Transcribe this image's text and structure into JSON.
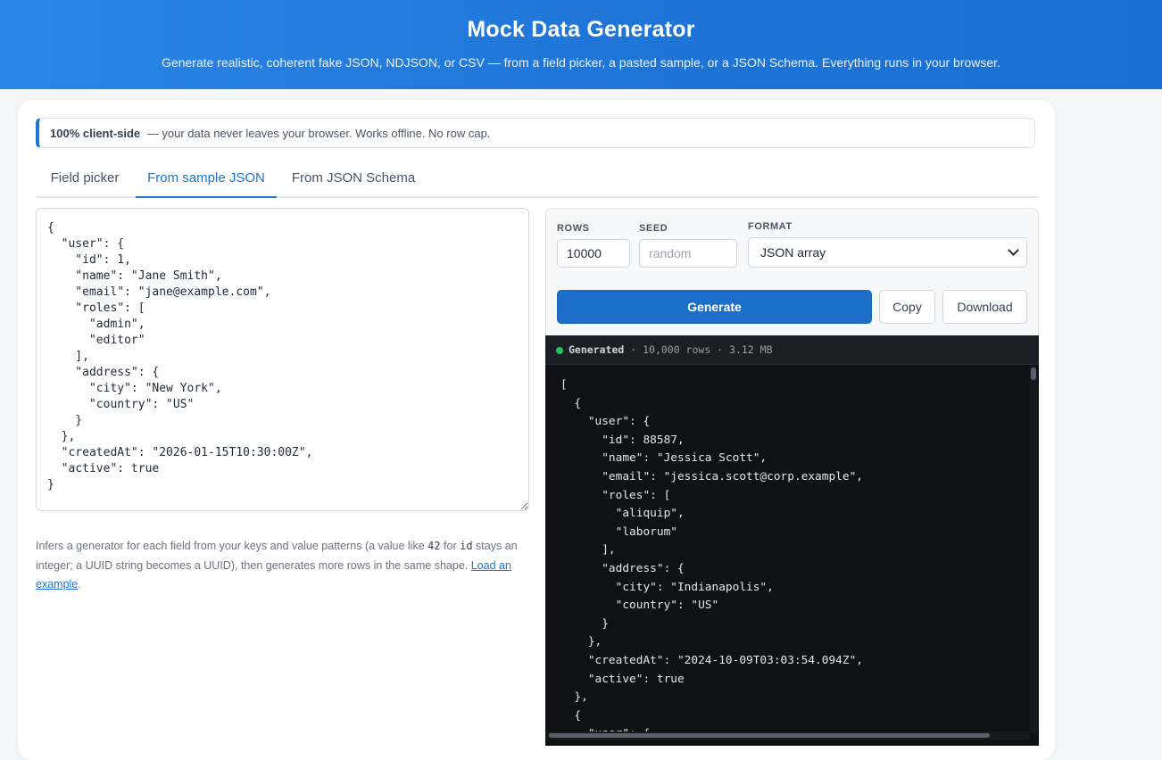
{
  "header": {
    "title": "Mock Data Generator",
    "subtitle": "Generate realistic, coherent fake JSON, NDJSON, or CSV — from a field picker, a pasted sample, or a JSON Schema. Everything runs in your browser."
  },
  "notice": {
    "strong": "100% client-side",
    "text": "— your data never leaves your browser. Works offline. No row cap."
  },
  "tabs": [
    {
      "label": "Field picker",
      "active": false
    },
    {
      "label": "From sample JSON",
      "active": true
    },
    {
      "label": "From JSON Schema",
      "active": false
    }
  ],
  "sample": {
    "value": "{\n  \"user\": {\n    \"id\": 1,\n    \"name\": \"Jane Smith\",\n    \"email\": \"jane@example.com\",\n    \"roles\": [\n      \"admin\",\n      \"editor\"\n    ],\n    \"address\": {\n      \"city\": \"New York\",\n      \"country\": \"US\"\n    }\n  },\n  \"createdAt\": \"2026-01-15T10:30:00Z\",\n  \"active\": true\n}"
  },
  "help": {
    "part1": "Infers a generator for each field from your keys and value patterns (a value like ",
    "code1": "42",
    "part2": " for ",
    "code2": "id",
    "part3": " stays an integer; a UUID string becomes a UUID), then generates more rows in the same shape. ",
    "link": "Load an example",
    "end": "."
  },
  "controls": {
    "rows_label": "ROWS",
    "rows_value": "10000",
    "seed_label": "SEED",
    "seed_placeholder": "random",
    "format_label": "FORMAT",
    "format_value": "JSON array",
    "generate_label": "Generate",
    "copy_label": "Copy",
    "download_label": "Download"
  },
  "output": {
    "status_label": "Generated",
    "status_detail": "· 10,000 rows · 3.12 MB",
    "code": "[\n  {\n    \"user\": {\n      \"id\": 88587,\n      \"name\": \"Jessica Scott\",\n      \"email\": \"jessica.scott@corp.example\",\n      \"roles\": [\n        \"aliquip\",\n        \"laborum\"\n      ],\n      \"address\": {\n        \"city\": \"Indianapolis\",\n        \"country\": \"US\"\n      }\n    },\n    \"createdAt\": \"2024-10-09T03:03:54.094Z\",\n    \"active\": true\n  },\n  {\n    \"user\": {",
    "status_color": "#22c55e"
  },
  "colors": {
    "accent": "#1d73d6",
    "header_gradient_start": "#2b86e6",
    "generate_button": "#1d6ec9",
    "output_background": "#0f1115"
  }
}
